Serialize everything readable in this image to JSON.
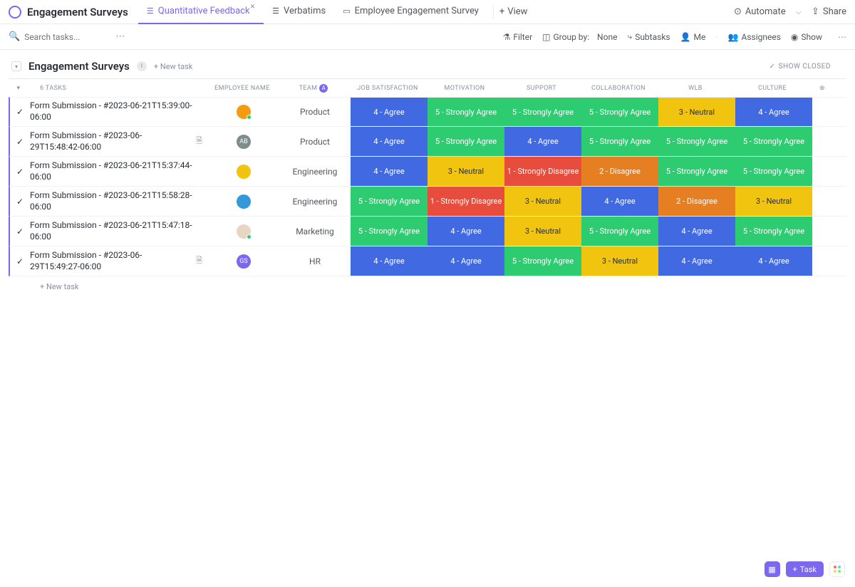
{
  "header": {
    "title": "Engagement Surveys",
    "tabs": [
      {
        "label": "Quantitative Feedback",
        "active": true,
        "closable": true
      },
      {
        "label": "Verbatims",
        "active": false
      },
      {
        "label": "Employee Engagement Survey",
        "active": false
      }
    ],
    "view_button": "View",
    "automate": "Automate",
    "share": "Share"
  },
  "toolbar": {
    "search_placeholder": "Search tasks...",
    "filter": "Filter",
    "group_by_label": "Group by:",
    "group_by_value": "None",
    "subtasks": "Subtasks",
    "me": "Me",
    "assignees": "Assignees",
    "show": "Show"
  },
  "group": {
    "title": "Engagement Surveys",
    "new_task": "+ New task",
    "show_closed": "SHOW CLOSED",
    "task_count_label": "6 TASKS"
  },
  "columns": {
    "employee_name": "EMPLOYEE NAME",
    "team": "TEAM",
    "job_satisfaction": "JOB SATISFACTION",
    "motivation": "MOTIVATION",
    "support": "SUPPORT",
    "collaboration": "COLLABORATION",
    "wlb": "WLB",
    "culture": "CULTURE"
  },
  "rows": [
    {
      "name": "Form Submission - #2023-06-21T15:39:00-06:00",
      "doc": false,
      "avatar": {
        "bg": "#f39c12",
        "initials": "",
        "img": true,
        "status": true
      },
      "team": "Product",
      "cells": [
        {
          "t": "4 - Agree",
          "c": "c-blue"
        },
        {
          "t": "5 - Strongly Agree",
          "c": "c-green"
        },
        {
          "t": "5 - Strongly Agree",
          "c": "c-green"
        },
        {
          "t": "5 - Strongly Agree",
          "c": "c-green"
        },
        {
          "t": "3 - Neutral",
          "c": "c-yellow"
        },
        {
          "t": "4 - Agree",
          "c": "c-blue"
        }
      ]
    },
    {
      "name": "Form Submission - #2023-06-29T15:48:42-06:00",
      "doc": true,
      "avatar": {
        "bg": "#7f8c8d",
        "initials": "AB",
        "img": false,
        "status": false
      },
      "team": "Product",
      "cells": [
        {
          "t": "4 - Agree",
          "c": "c-blue"
        },
        {
          "t": "5 - Strongly Agree",
          "c": "c-green"
        },
        {
          "t": "4 - Agree",
          "c": "c-blue"
        },
        {
          "t": "5 - Strongly Agree",
          "c": "c-green"
        },
        {
          "t": "5 - Strongly Agree",
          "c": "c-green"
        },
        {
          "t": "5 - Strongly Agree",
          "c": "c-green"
        }
      ]
    },
    {
      "name": "Form Submission - #2023-06-21T15:37:44-06:00",
      "doc": false,
      "avatar": {
        "bg": "#f1c40f",
        "initials": "",
        "img": true,
        "status": false
      },
      "team": "Engineering",
      "cells": [
        {
          "t": "4 - Agree",
          "c": "c-blue"
        },
        {
          "t": "3 - Neutral",
          "c": "c-yellow"
        },
        {
          "t": "1 - Strongly Disagree",
          "c": "c-red"
        },
        {
          "t": "2 - Disagree",
          "c": "c-orange"
        },
        {
          "t": "5 - Strongly Agree",
          "c": "c-green"
        },
        {
          "t": "5 - Strongly Agree",
          "c": "c-green"
        }
      ]
    },
    {
      "name": "Form Submission - #2023-06-21T15:58:28-06:00",
      "doc": false,
      "avatar": {
        "bg": "#3498db",
        "initials": "",
        "img": true,
        "status": false
      },
      "team": "Engineering",
      "cells": [
        {
          "t": "5 - Strongly Agree",
          "c": "c-green"
        },
        {
          "t": "1 - Strongly Disagree",
          "c": "c-red"
        },
        {
          "t": "3 - Neutral",
          "c": "c-yellow"
        },
        {
          "t": "4 - Agree",
          "c": "c-blue"
        },
        {
          "t": "2 - Disagree",
          "c": "c-orange"
        },
        {
          "t": "3 - Neutral",
          "c": "c-yellow"
        }
      ]
    },
    {
      "name": "Form Submission - #2023-06-21T15:47:18-06:00",
      "doc": false,
      "avatar": {
        "bg": "#e8d5c4",
        "initials": "",
        "img": true,
        "status": true
      },
      "team": "Marketing",
      "cells": [
        {
          "t": "5 - Strongly Agree",
          "c": "c-green"
        },
        {
          "t": "4 - Agree",
          "c": "c-blue"
        },
        {
          "t": "3 - Neutral",
          "c": "c-yellow"
        },
        {
          "t": "5 - Strongly Agree",
          "c": "c-green"
        },
        {
          "t": "4 - Agree",
          "c": "c-blue"
        },
        {
          "t": "5 - Strongly Agree",
          "c": "c-green"
        }
      ]
    },
    {
      "name": "Form Submission - #2023-06-29T15:49:27-06:00",
      "doc": true,
      "avatar": {
        "bg": "#7b68ee",
        "initials": "GS",
        "img": false,
        "status": false
      },
      "team": "HR",
      "cells": [
        {
          "t": "4 - Agree",
          "c": "c-blue"
        },
        {
          "t": "4 - Agree",
          "c": "c-blue"
        },
        {
          "t": "5 - Strongly Agree",
          "c": "c-green"
        },
        {
          "t": "3 - Neutral",
          "c": "c-yellow"
        },
        {
          "t": "4 - Agree",
          "c": "c-blue"
        },
        {
          "t": "4 - Agree",
          "c": "c-blue"
        }
      ]
    }
  ],
  "footer": {
    "add_task": "+ New task",
    "task_button": "Task"
  }
}
